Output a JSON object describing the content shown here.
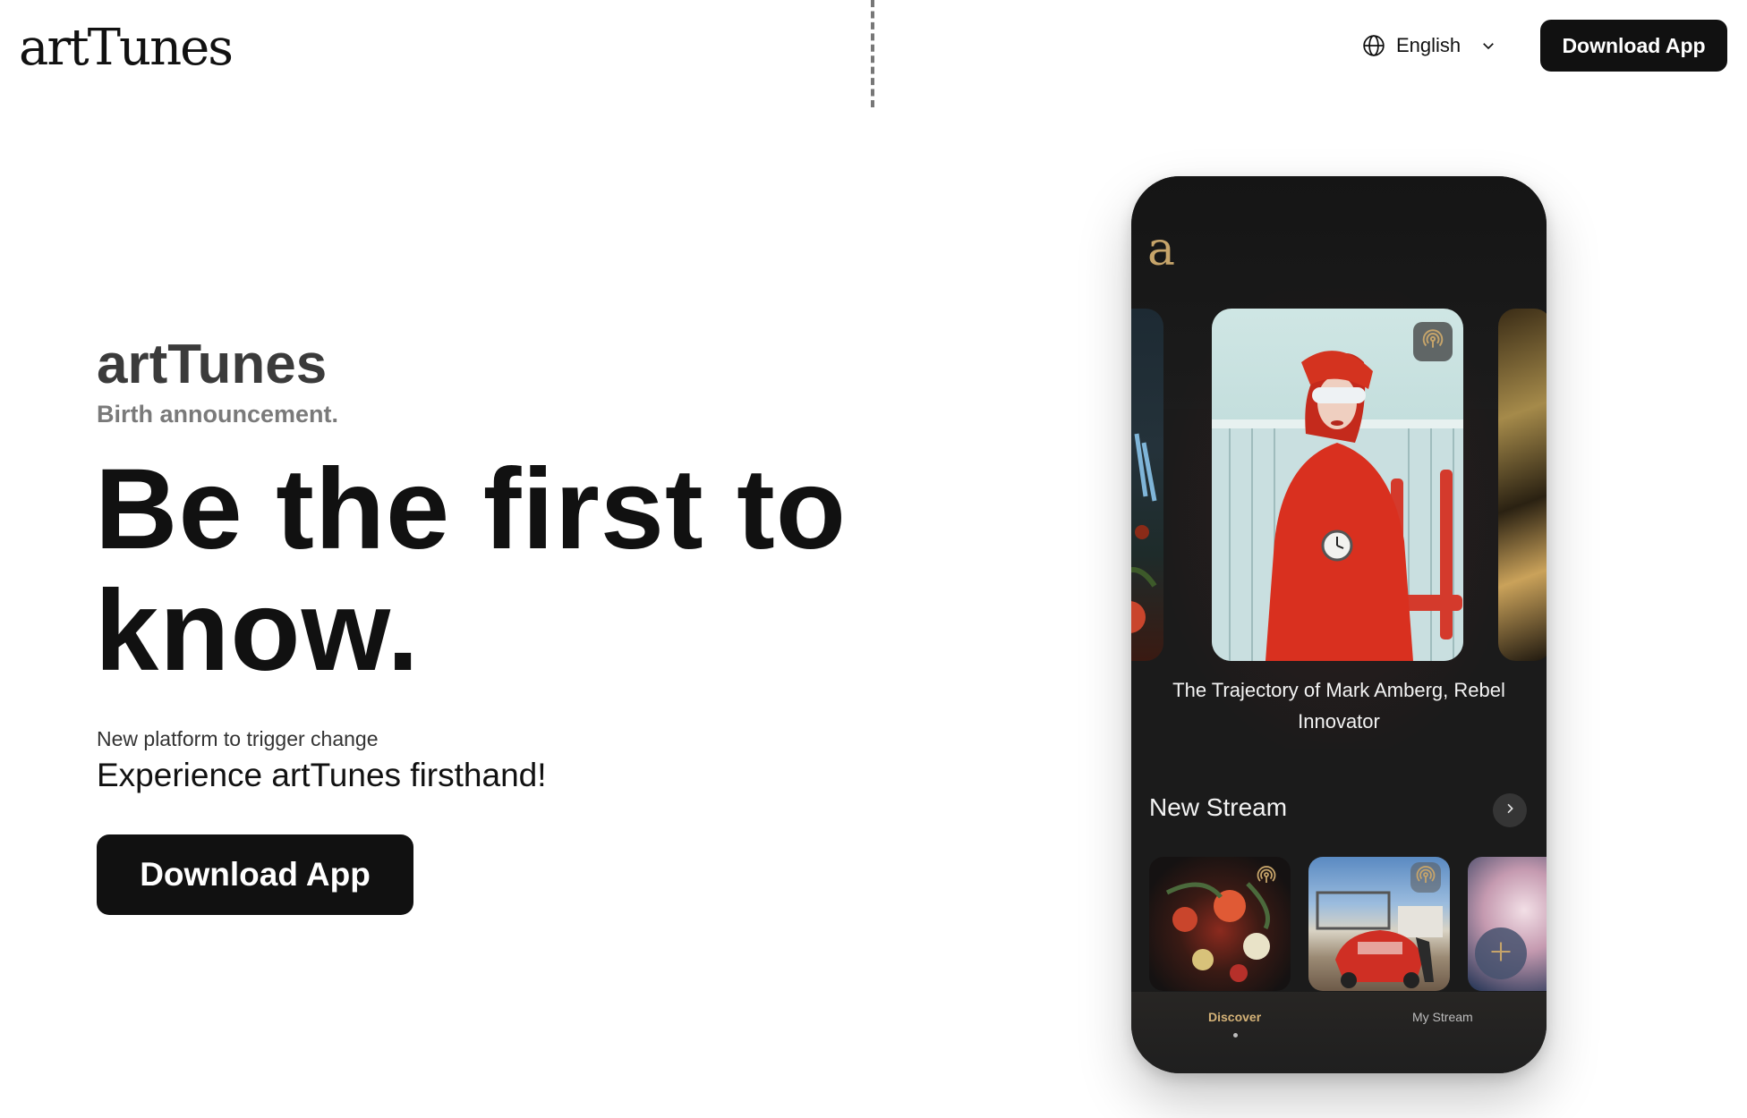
{
  "header": {
    "logo": "artTunes",
    "language": "English",
    "download_label": "Download App"
  },
  "hero": {
    "brand": "artTunes",
    "sub_brand": "Birth announcement.",
    "headline": "Be the first to know.",
    "tagline_small": "New platform to trigger change",
    "tagline_large": "Experience artTunes firsthand!",
    "download_label": "Download App"
  },
  "phone": {
    "app_logo": "a",
    "featured_title": "The Trajectory of Mark Amberg, Rebel Innovator",
    "section_title": "New Stream",
    "tabs": [
      {
        "label": "Discover",
        "active": true
      },
      {
        "label": "My Stream",
        "active": false
      }
    ]
  },
  "colors": {
    "primary_button": "#111111",
    "accent_gold": "#c6a46a",
    "phone_background": "#1b1b1b"
  }
}
